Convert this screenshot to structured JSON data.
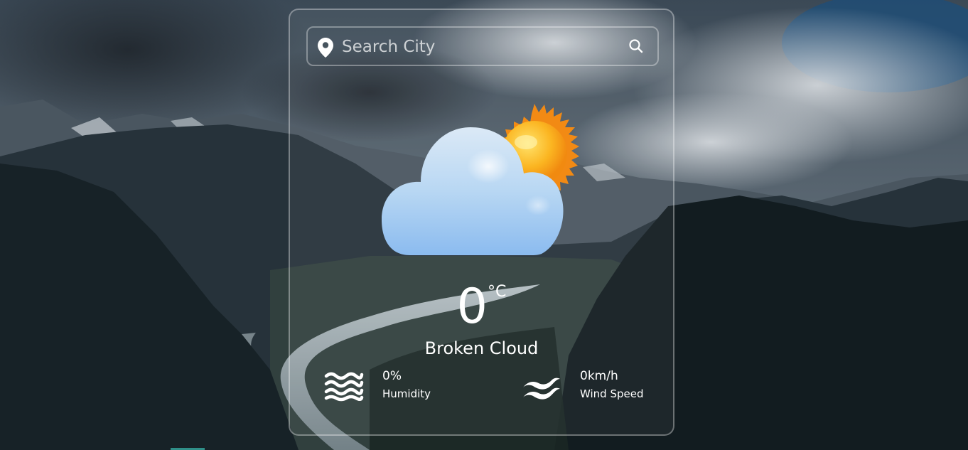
{
  "search": {
    "placeholder": "Search City",
    "location_icon": "map-pin-icon",
    "search_icon": "search-icon"
  },
  "weather": {
    "icon": "cloud-sun-icon",
    "temperature": "0",
    "unit": "°C",
    "condition": "Broken Cloud"
  },
  "stats": {
    "humidity": {
      "icon": "waves-icon",
      "value": "0%",
      "label": "Humidity"
    },
    "wind": {
      "icon": "wind-icon",
      "value": "0km/h",
      "label": "Wind Speed"
    }
  },
  "colors": {
    "card_border": "#ffffff",
    "text": "#ffffff",
    "sun": "#f7a51c",
    "cloud": "#a9d2f5"
  }
}
